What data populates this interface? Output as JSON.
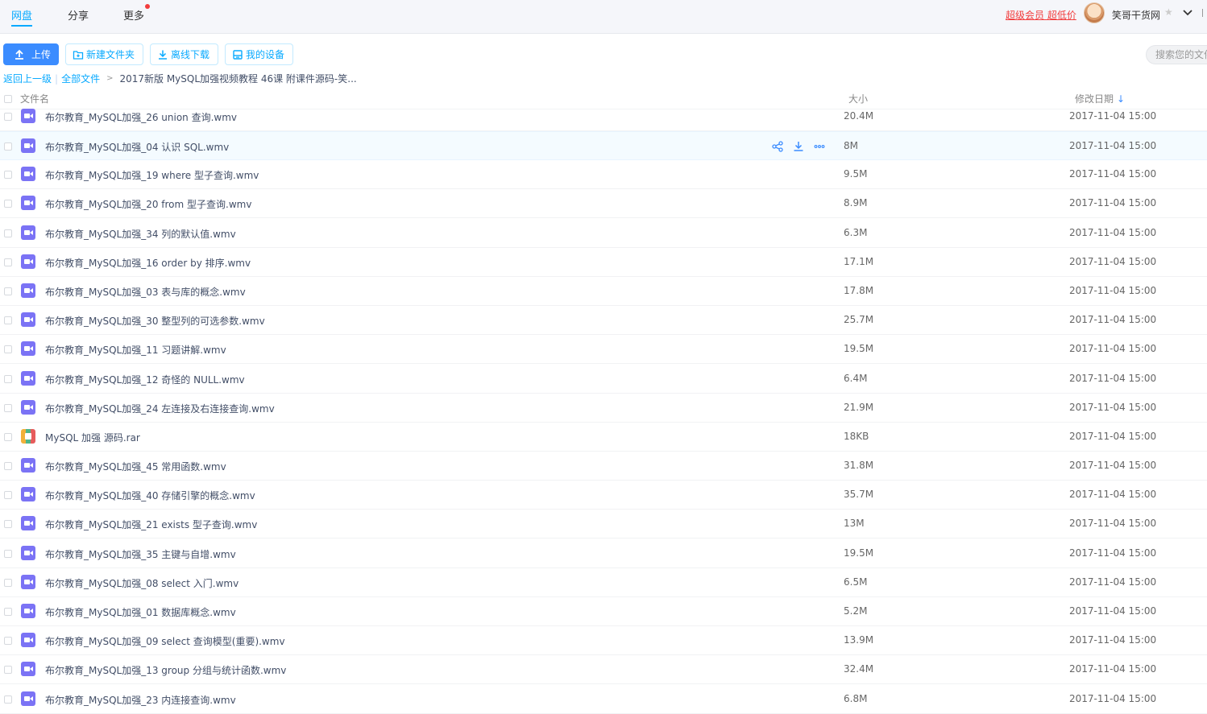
{
  "nav": {
    "tabs": [
      {
        "label": "网盘",
        "active": true
      },
      {
        "label": "分享",
        "active": false
      },
      {
        "label": "更多",
        "active": false
      }
    ],
    "vip_text": "超级会员 超低价",
    "username": "笑哥干货网"
  },
  "toolbar": {
    "upload": "上传",
    "new_folder": "新建文件夹",
    "offline_download": "离线下载",
    "my_devices": "我的设备",
    "search_placeholder": "搜索您的文件"
  },
  "breadcrumb": {
    "back": "返回上一级",
    "separator": "|",
    "all_files": "全部文件",
    "arrow": ">",
    "current": "2017新版 MySQL加强视频教程 46课 附课件源码-笑..."
  },
  "table": {
    "headers": {
      "name": "文件名",
      "size": "大小",
      "date": "修改日期"
    },
    "sort_indicator": "↓",
    "rows": [
      {
        "name": "布尔教育_MySQL加强_26 union 查询.wmv",
        "size": "20.4M",
        "date": "2017-11-04 15:00",
        "type": "video"
      },
      {
        "name": "布尔教育_MySQL加强_04 认识 SQL.wmv",
        "size": "8M",
        "date": "2017-11-04 15:00",
        "type": "video",
        "hover": true
      },
      {
        "name": "布尔教育_MySQL加强_19 where 型子查询.wmv",
        "size": "9.5M",
        "date": "2017-11-04 15:00",
        "type": "video"
      },
      {
        "name": "布尔教育_MySQL加强_20 from 型子查询.wmv",
        "size": "8.9M",
        "date": "2017-11-04 15:00",
        "type": "video"
      },
      {
        "name": "布尔教育_MySQL加强_34 列的默认值.wmv",
        "size": "6.3M",
        "date": "2017-11-04 15:00",
        "type": "video"
      },
      {
        "name": "布尔教育_MySQL加强_16 order by 排序.wmv",
        "size": "17.1M",
        "date": "2017-11-04 15:00",
        "type": "video"
      },
      {
        "name": "布尔教育_MySQL加强_03 表与库的概念.wmv",
        "size": "17.8M",
        "date": "2017-11-04 15:00",
        "type": "video"
      },
      {
        "name": "布尔教育_MySQL加强_30 整型列的可选参数.wmv",
        "size": "25.7M",
        "date": "2017-11-04 15:00",
        "type": "video"
      },
      {
        "name": "布尔教育_MySQL加强_11 习题讲解.wmv",
        "size": "19.5M",
        "date": "2017-11-04 15:00",
        "type": "video"
      },
      {
        "name": "布尔教育_MySQL加强_12 奇怪的 NULL.wmv",
        "size": "6.4M",
        "date": "2017-11-04 15:00",
        "type": "video"
      },
      {
        "name": "布尔教育_MySQL加强_24 左连接及右连接查询.wmv",
        "size": "21.9M",
        "date": "2017-11-04 15:00",
        "type": "video"
      },
      {
        "name": "MySQL 加强 源码.rar",
        "size": "18KB",
        "date": "2017-11-04 15:00",
        "type": "rar"
      },
      {
        "name": "布尔教育_MySQL加强_45 常用函数.wmv",
        "size": "31.8M",
        "date": "2017-11-04 15:00",
        "type": "video"
      },
      {
        "name": "布尔教育_MySQL加强_40 存储引擎的概念.wmv",
        "size": "35.7M",
        "date": "2017-11-04 15:00",
        "type": "video"
      },
      {
        "name": "布尔教育_MySQL加强_21 exists 型子查询.wmv",
        "size": "13M",
        "date": "2017-11-04 15:00",
        "type": "video"
      },
      {
        "name": "布尔教育_MySQL加强_35 主键与自增.wmv",
        "size": "19.5M",
        "date": "2017-11-04 15:00",
        "type": "video"
      },
      {
        "name": "布尔教育_MySQL加强_08 select 入门.wmv",
        "size": "6.5M",
        "date": "2017-11-04 15:00",
        "type": "video"
      },
      {
        "name": "布尔教育_MySQL加强_01 数据库概念.wmv",
        "size": "5.2M",
        "date": "2017-11-04 15:00",
        "type": "video"
      },
      {
        "name": "布尔教育_MySQL加强_09 select 查询模型(重要).wmv",
        "size": "13.9M",
        "date": "2017-11-04 15:00",
        "type": "video"
      },
      {
        "name": "布尔教育_MySQL加强_13 group 分组与统计函数.wmv",
        "size": "32.4M",
        "date": "2017-11-04 15:00",
        "type": "video"
      },
      {
        "name": "布尔教育_MySQL加强_23 内连接查询.wmv",
        "size": "6.8M",
        "date": "2017-11-04 15:00",
        "type": "video"
      }
    ]
  },
  "colors": {
    "accent": "#09aaff",
    "primary_button": "#3b8cff",
    "vip": "#f23c3c",
    "video_icon": "#7b73f5"
  },
  "icons": [
    "upload-icon",
    "new-folder-icon",
    "download-icon",
    "device-icon",
    "share-icon",
    "more-icon",
    "chevron-down-icon",
    "video-file-icon",
    "archive-file-icon"
  ]
}
